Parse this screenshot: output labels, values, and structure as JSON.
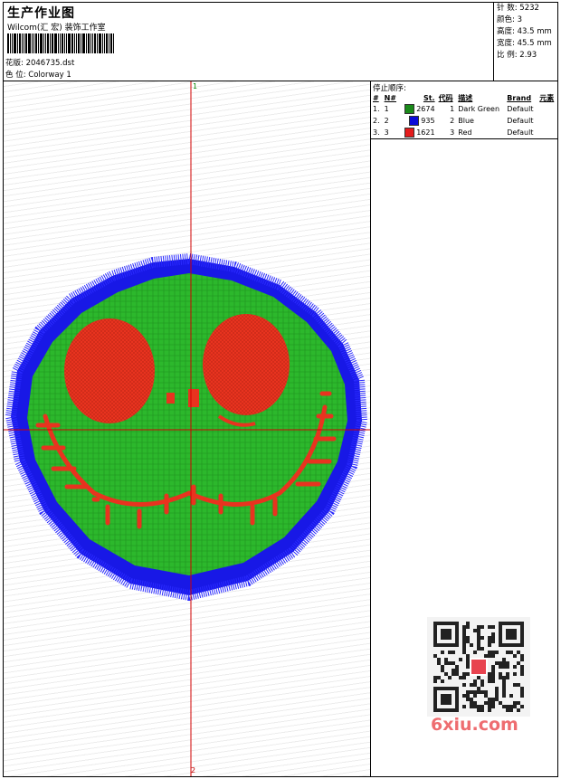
{
  "header": {
    "title": "生产作业图",
    "company": "Wilcom(汇 宏) 装饰工作室",
    "file_label": "花版: 2046735.dst",
    "colorway_label": "色 位:  Colorway 1"
  },
  "specs": [
    {
      "label": "针 数:",
      "value": "5232"
    },
    {
      "label": "颜色:",
      "value": "3"
    },
    {
      "label": "高度:",
      "value": "43.5 mm"
    },
    {
      "label": "宽度:",
      "value": "45.5 mm"
    },
    {
      "label": "比 例:",
      "value": "2.93"
    }
  ],
  "stop_sequence": {
    "title": "停止顺序:",
    "headers": [
      "#",
      "N#",
      "St.",
      "代码",
      "描述",
      "Brand",
      "元素"
    ],
    "rows": [
      {
        "num": "1.",
        "n": "1",
        "color": "#1a8a1a",
        "stitches": "2674",
        "code": "1",
        "desc": "Dark Green",
        "brand": "Default"
      },
      {
        "num": "2.",
        "n": "2",
        "color": "#0b0bd8",
        "stitches": "935",
        "code": "2",
        "desc": "Blue",
        "brand": "Default"
      },
      {
        "num": "3.",
        "n": "3",
        "color": "#e41c1c",
        "stitches": "1621",
        "code": "3",
        "desc": "Red",
        "brand": "Default"
      }
    ]
  },
  "design": {
    "axis_top": "1",
    "axis_bottom": "2",
    "fill_color": "#2fb82f",
    "border_color": "#1a1aee",
    "detail_color": "#e8331f"
  },
  "watermark": "6xiu.com"
}
